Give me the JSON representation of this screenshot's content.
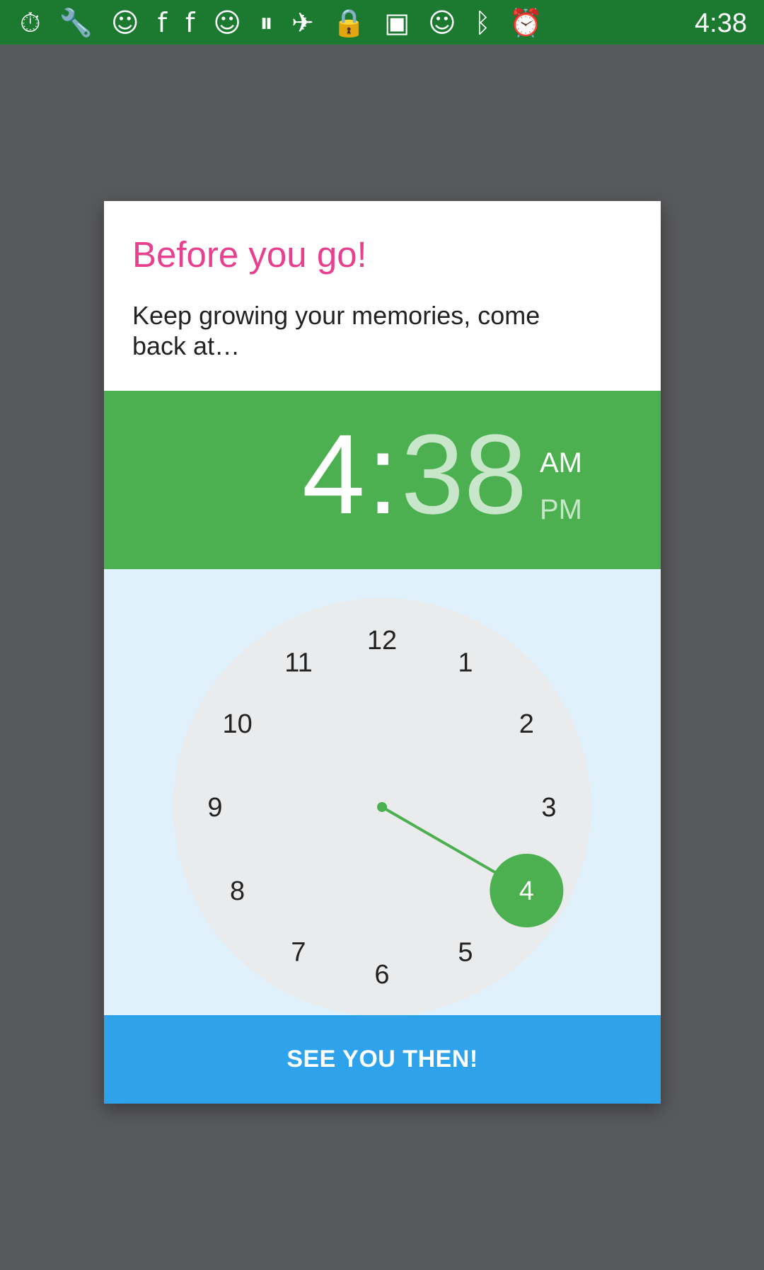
{
  "status_bar": {
    "icons": [
      "stopwatch-icon",
      "wrench-icon",
      "smiley-icon",
      "facebook-icon",
      "facebook-icon",
      "smiley-icon",
      "circle-pause-icon",
      "fake-gps-icon",
      "lock-icon",
      "android-icon",
      "smiley-icon",
      "bluetooth-icon",
      "alarm-icon"
    ],
    "time": "4:38"
  },
  "dialog": {
    "title": "Before you go!",
    "message": "Keep growing your memories, come back at…",
    "time": {
      "hour": "4",
      "separator": ":",
      "minute": "38",
      "am": "AM",
      "pm": "PM",
      "selected_period": "AM"
    },
    "clock": {
      "numbers": [
        "12",
        "1",
        "2",
        "3",
        "4",
        "5",
        "6",
        "7",
        "8",
        "9",
        "10",
        "11"
      ],
      "selected_hour": 4
    },
    "button_label": "SEE YOU THEN!"
  },
  "colors": {
    "accent_pink": "#e8408f",
    "header_green": "#4caf50",
    "clock_face": "#eaebec",
    "clock_bg": "#e0f1fb",
    "button_blue": "#2ea3ec",
    "overlay": "#58595b"
  }
}
